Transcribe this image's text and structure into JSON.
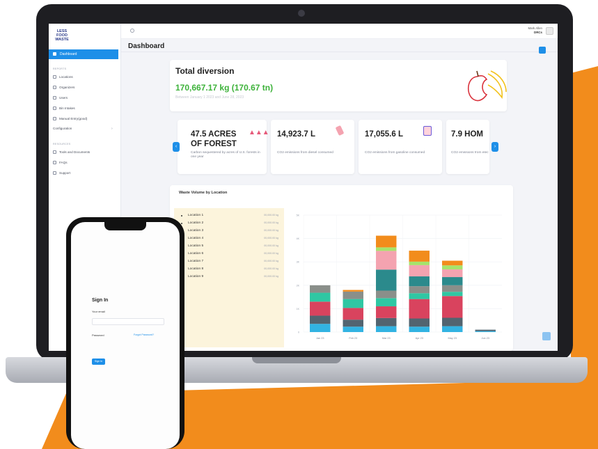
{
  "colors": {
    "orange": "#f28c1c",
    "accent": "#1e8fe8",
    "green": "#3db23a",
    "legend_bg": "#fcf4dc"
  },
  "logo": {
    "line1": "LESS",
    "line2": "FOOD",
    "line3": "WASTE"
  },
  "sidebar": {
    "active": "Dashboard",
    "section1": "REPORTS",
    "items": [
      "Locations",
      "Organizers",
      "Users",
      "Bin Intakes",
      "Manual Entry(good)",
      "Configuration"
    ],
    "section2": "RESOURCES",
    "resources": [
      "Tools and Documents",
      "FAQs",
      "Support"
    ]
  },
  "header": {
    "title": "Dashboard",
    "user_name": "Mark Allen",
    "user_org": "DRCs"
  },
  "total_diversion": {
    "label": "Total diversion",
    "value": "170,667.17 kg (170.67 tn)",
    "subtitle": "Between January 1 2023 and June 28, 2023"
  },
  "stats": [
    {
      "value": "47.5 ACRES",
      "value2": "OF FOREST",
      "desc": "Carbon sequestered by acres of U.S. forests in one year"
    },
    {
      "value": "14,923.7 L",
      "desc": "CO2 emissions from diesel consumed"
    },
    {
      "value": "17,055.6 L",
      "desc": "CO2 emissions from gasoline consumed"
    },
    {
      "value": "7.9 HOM",
      "desc": "CO2 emissions from electricity use for"
    }
  ],
  "chart_title": "Waste Volume by Location",
  "legend": [
    {
      "name": "Location 1",
      "value": "00,000.00 kg"
    },
    {
      "name": "Location 2",
      "value": "00,000.00 kg"
    },
    {
      "name": "Location 3",
      "value": "00,000.00 kg"
    },
    {
      "name": "Location 4",
      "value": "00,000.00 kg"
    },
    {
      "name": "Location 5",
      "value": "00,000.00 kg"
    },
    {
      "name": "Location 6",
      "value": "00,000.00 kg"
    },
    {
      "name": "Location 7",
      "value": "00,000.00 kg"
    },
    {
      "name": "Location 8",
      "value": "00,000.00 kg"
    },
    {
      "name": "Location 9",
      "value": "00,000.00 kg"
    }
  ],
  "chart_data": {
    "type": "bar",
    "categories": [
      "Jan 23",
      "Feb 23",
      "Mar 23",
      "Apr 23",
      "May 23",
      "Jun 23"
    ],
    "y_ticks": [
      "5K",
      "4K",
      "3K",
      "2K",
      "1K",
      "0"
    ],
    "ylim": [
      0,
      5000
    ],
    "colors": [
      "#32b3e2",
      "#526470",
      "#d9435e",
      "#2fc7a3",
      "#8a8f8a",
      "#2b8a8c",
      "#f4a3b0",
      "#a6e36b",
      "#f28c1c"
    ],
    "series": [
      {
        "name": "Location 1",
        "values": [
          350,
          230,
          250,
          230,
          250,
          40
        ]
      },
      {
        "name": "Location 2",
        "values": [
          350,
          300,
          350,
          350,
          360,
          60
        ]
      },
      {
        "name": "Location 3",
        "values": [
          600,
          500,
          500,
          830,
          930,
          0
        ]
      },
      {
        "name": "Location 4",
        "values": [
          380,
          380,
          350,
          250,
          180,
          0
        ]
      },
      {
        "name": "Location 5",
        "values": [
          320,
          320,
          320,
          300,
          280,
          0
        ]
      },
      {
        "name": "Location 6",
        "values": [
          0,
          0,
          900,
          420,
          350,
          0
        ]
      },
      {
        "name": "Location 7",
        "values": [
          0,
          0,
          800,
          480,
          330,
          0
        ]
      },
      {
        "name": "Location 8",
        "values": [
          0,
          0,
          150,
          150,
          170,
          0
        ]
      },
      {
        "name": "Location 9",
        "values": [
          0,
          70,
          500,
          470,
          200,
          0
        ]
      }
    ]
  },
  "phone": {
    "title": "Sign In",
    "email_label": "Your email",
    "password_label": "Password",
    "forgot": "Forgot Password?",
    "button": "Sign In"
  }
}
